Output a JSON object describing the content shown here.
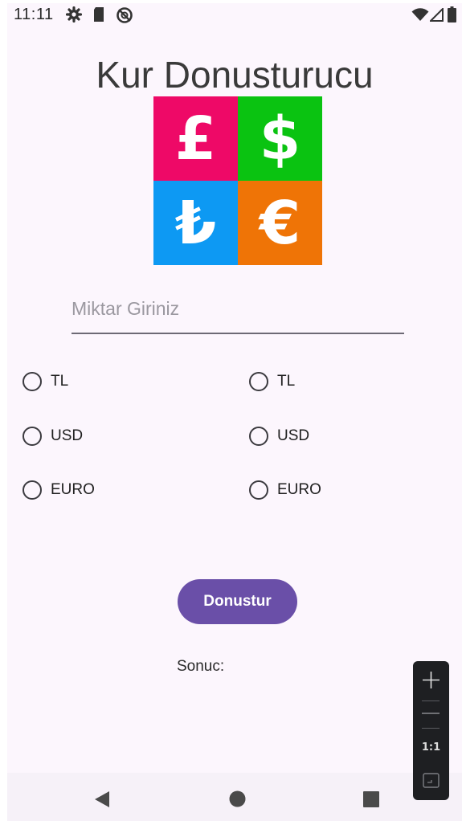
{
  "status_bar": {
    "time": "11:11",
    "icons": [
      "gear-icon",
      "sd-card-icon",
      "no-sync-icon",
      "wifi-icon",
      "signal-icon",
      "battery-icon"
    ]
  },
  "app": {
    "title": "Kur Donusturucu",
    "currency_symbols": [
      "£",
      "$",
      "₺",
      "€"
    ],
    "currency_colors": [
      "#ee0967",
      "#0ac311",
      "#0d99f3",
      "#ef7406"
    ]
  },
  "amount_input": {
    "placeholder": "Miktar Giriniz",
    "value": ""
  },
  "from_options": [
    {
      "label": "TL",
      "selected": false
    },
    {
      "label": "USD",
      "selected": false
    },
    {
      "label": "EURO",
      "selected": false
    }
  ],
  "to_options": [
    {
      "label": "TL",
      "selected": false
    },
    {
      "label": "USD",
      "selected": false
    },
    {
      "label": "EURO",
      "selected": false
    }
  ],
  "convert_button": {
    "label": "Donustur",
    "color": "#6a4fa8"
  },
  "result": {
    "label": "Sonuc:"
  },
  "nav_bar": {
    "icons": [
      "back-icon",
      "home-icon",
      "recents-icon"
    ]
  },
  "zoom_panel": {
    "icons": [
      "zoom-in-icon",
      "zoom-out-icon",
      "fit-screen-icon"
    ],
    "reset_label": "1:1"
  }
}
